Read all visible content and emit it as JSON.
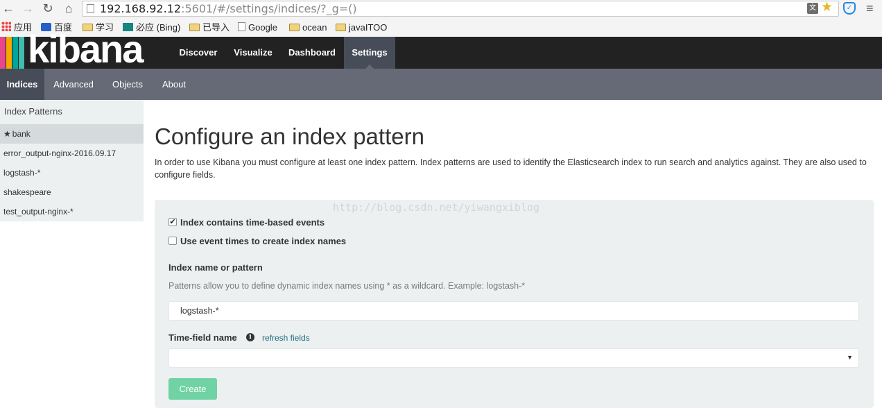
{
  "browser": {
    "url_host": "192.168.92.12",
    "url_rest": ":5601/#/settings/indices/?_g=()",
    "bookmarks": [
      "应用",
      "百度",
      "学习",
      "必应 (Bing)",
      "已导入",
      "Google",
      "ocean",
      "javaITOO"
    ]
  },
  "app": {
    "logo_text": "kibana",
    "logo_colors": [
      "#e8488b",
      "#f5a800",
      "#00a69b",
      "#3ebeb0"
    ],
    "top_nav": [
      "Discover",
      "Visualize",
      "Dashboard",
      "Settings"
    ],
    "active_top": "Settings",
    "sub_nav": [
      "Indices",
      "Advanced",
      "Objects",
      "About"
    ],
    "active_sub": "Indices"
  },
  "sidebar": {
    "heading": "Index Patterns",
    "items": [
      "bank",
      "error_output-nginx-2016.09.17",
      "logstash-*",
      "shakespeare",
      "test_output-nginx-*"
    ],
    "default_item": "bank"
  },
  "main": {
    "title": "Configure an index pattern",
    "intro": "In order to use Kibana you must configure at least one index pattern. Index patterns are used to identify the Elasticsearch index to run search and analytics against. They are also used to configure fields.",
    "watermark": "http://blog.csdn.net/yiwangxiblog",
    "checkbox_time_based": "Index contains time-based events",
    "checkbox_time_based_checked": true,
    "checkbox_event_times": "Use event times to create index names",
    "checkbox_event_times_checked": false,
    "index_label": "Index name or pattern",
    "index_help": "Patterns allow you to define dynamic index names using * as a wildcard. Example: logstash-*",
    "index_value": "logstash-*",
    "time_field_label": "Time-field name",
    "refresh_link": "refresh fields",
    "time_field_value": "",
    "create_button": "Create",
    "create_color": "#6fd3a3"
  }
}
